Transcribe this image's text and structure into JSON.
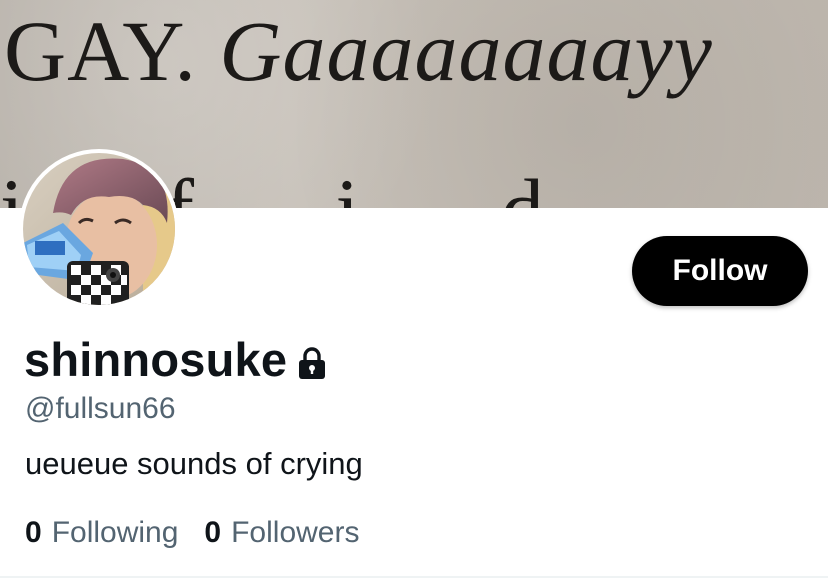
{
  "banner": {
    "line1_plain": "GAY. ",
    "line1_italic": "Gaaaaaaaayy",
    "line2": "i f i d"
  },
  "profile": {
    "display_name": "shinnosuke",
    "handle": "@fullsun66",
    "bio": "ueueue sounds of crying",
    "locked_icon": "lock-icon"
  },
  "actions": {
    "follow_label": "Follow"
  },
  "stats": {
    "following_count": "0",
    "following_label": "Following",
    "followers_count": "0",
    "followers_label": "Followers"
  },
  "colors": {
    "primary_text": "#0f1419",
    "secondary_text": "#536471",
    "button_bg": "#000000",
    "button_text": "#ffffff"
  }
}
